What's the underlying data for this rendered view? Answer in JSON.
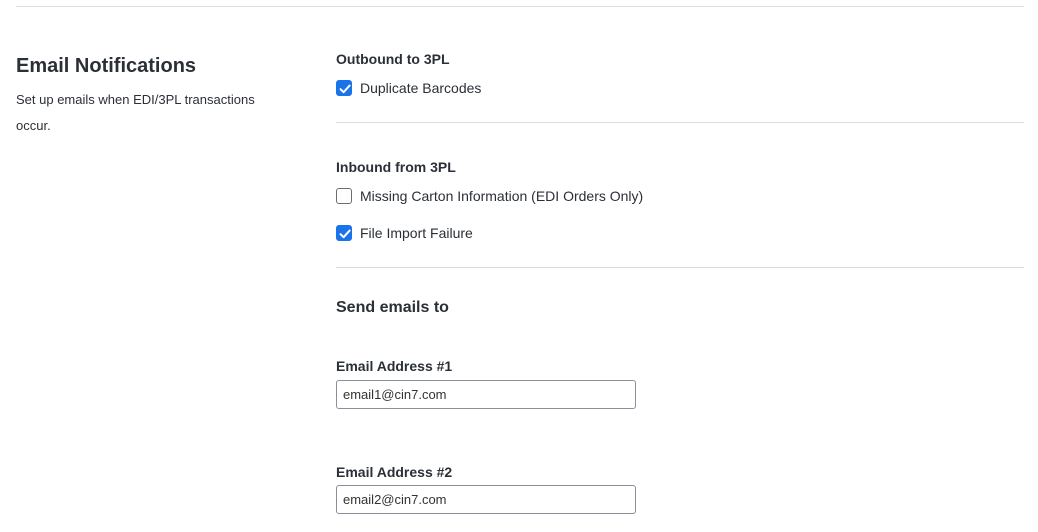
{
  "section": {
    "title": "Email Notifications",
    "description": "Set up emails when EDI/3PL transactions occur."
  },
  "outbound": {
    "heading": "Outbound to 3PL",
    "items": [
      {
        "label": "Duplicate Barcodes",
        "checked": true
      }
    ]
  },
  "inbound": {
    "heading": "Inbound from 3PL",
    "items": [
      {
        "label": "Missing Carton Information (EDI Orders Only)",
        "checked": false
      },
      {
        "label": "File Import Failure",
        "checked": true
      }
    ]
  },
  "send": {
    "heading": "Send emails to",
    "emails": [
      {
        "label": "Email Address #1",
        "value": "email1@cin7.com"
      },
      {
        "label": "Email Address #2",
        "value": "email2@cin7.com"
      }
    ]
  },
  "colors": {
    "checkbox_checked": "#1a73e8",
    "divider": "#dcdcdc",
    "text": "#2b2f36"
  }
}
